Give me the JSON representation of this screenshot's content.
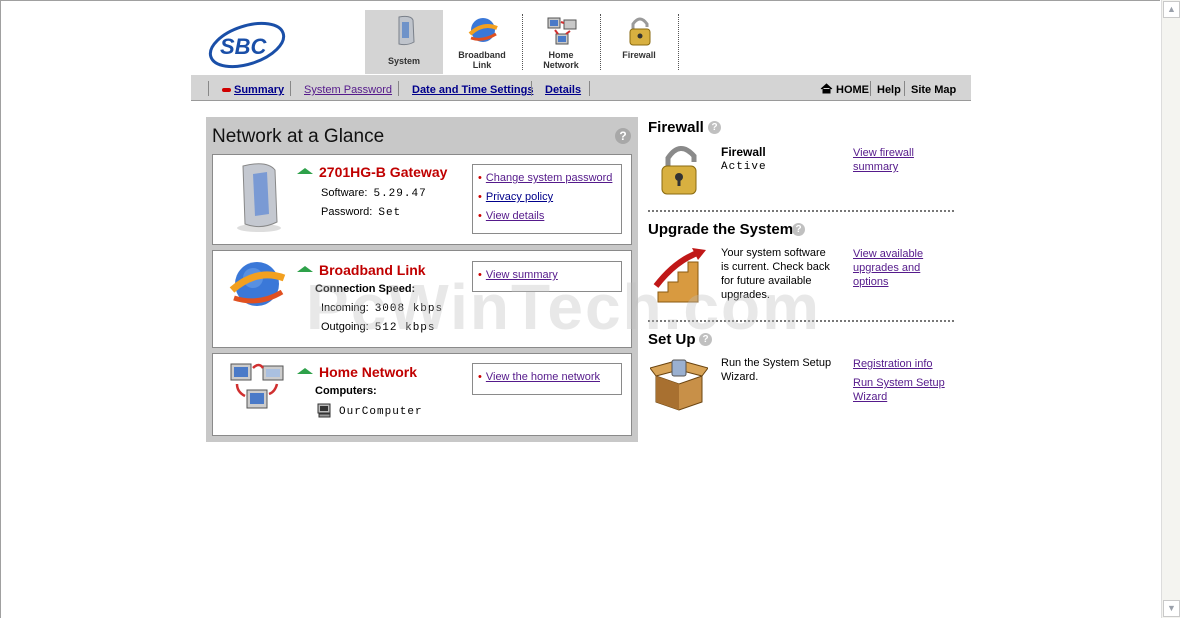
{
  "brand": {
    "logo_text": "SBC"
  },
  "tabs": [
    {
      "label": "System",
      "icon": "gateway-icon"
    },
    {
      "label": "Broadband\nLink",
      "icon": "globe-icon"
    },
    {
      "label": "Home\nNetwork",
      "icon": "network-icon"
    },
    {
      "label": "Firewall",
      "icon": "lock-icon"
    }
  ],
  "subnav": {
    "items": [
      "Summary",
      "System Password",
      "Date and Time Settings",
      "Details"
    ],
    "home": "HOME",
    "help": "Help",
    "sitemap": "Site Map"
  },
  "glance": {
    "title": "Network at a Glance",
    "help": "?",
    "gateway": {
      "title": "2701HG-B Gateway",
      "software_label": "Software:",
      "software_value": "5.29.47",
      "password_label": "Password:",
      "password_value": "Set",
      "links": [
        "Change system password",
        "Privacy policy",
        "View details"
      ]
    },
    "broadband": {
      "title": "Broadband Link",
      "speed_label": "Connection Speed:",
      "incoming_label": "Incoming:",
      "incoming_value": "3008 kbps",
      "outgoing_label": "Outgoing:",
      "outgoing_value": "512 kbps",
      "links": [
        "View summary"
      ]
    },
    "home_network": {
      "title": "Home Network",
      "computers_label": "Computers:",
      "computer_name": "OurComputer",
      "links": [
        "View the home network"
      ]
    }
  },
  "firewall": {
    "title": "Firewall",
    "help": "?",
    "name": "Firewall",
    "status": "Active",
    "link_line1": "View firewall",
    "link_line2": "summary"
  },
  "upgrade": {
    "title": "Upgrade the System",
    "help": "?",
    "text": [
      "Your system software",
      "is current. Check back",
      "for future available",
      "upgrades."
    ],
    "link": [
      "View available",
      "upgrades and",
      "options"
    ]
  },
  "setup": {
    "title": "Set Up",
    "help": "?",
    "text": [
      "Run the System Setup",
      "Wizard."
    ],
    "link1": "Registration info",
    "link2": [
      "Run System Setup",
      "Wizard"
    ]
  },
  "watermark": "PcWinTech.com",
  "colors": {
    "accent_red": "#c00000",
    "link": "#551a8b",
    "panel_gray": "#c8c8c8",
    "nav_gray": "#d4d4d4"
  }
}
